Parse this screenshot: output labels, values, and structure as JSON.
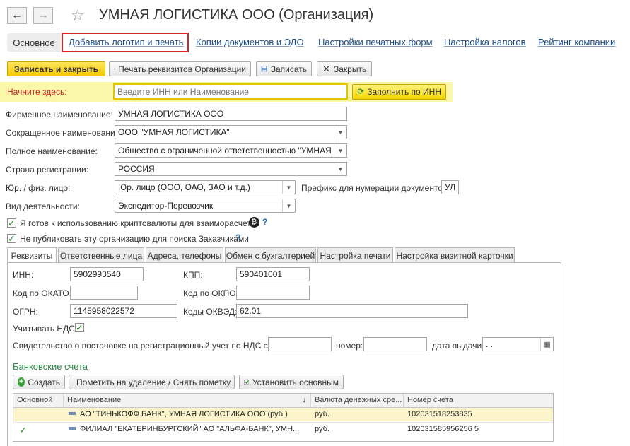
{
  "header": {
    "title": "УМНАЯ ЛОГИСТИКА ООО (Организация)",
    "back_glyph": "←",
    "forward_glyph": "→",
    "star_glyph": "☆"
  },
  "main_tabs": {
    "basic": "Основное",
    "logo": "Добавить логотип и печать",
    "copies": "Копии документов и ЭДО",
    "print_settings": "Настройки печатных форм",
    "taxes": "Настройка налогов",
    "rating": "Рейтинг компании"
  },
  "toolbar": {
    "save_close": "Записать и закрыть",
    "print_details": "Печать реквизитов Организации",
    "save": "Записать",
    "close": "Закрыть"
  },
  "start": {
    "label": "Начните здесь:",
    "placeholder": "Введите ИНН или Наименование",
    "fill_button": "Заполнить по ИНН"
  },
  "form": {
    "firm_name_label": "Фирменное наименование:",
    "firm_name": "УМНАЯ ЛОГИСТИКА ООО",
    "short_name_label": "Сокращенное наименование:",
    "short_name": "ООО \"УМНАЯ ЛОГИСТИКА\"",
    "full_name_label": "Полное наименование:",
    "full_name": "Общество с ограниченной ответственностью \"УМНАЯ ЛОГИ",
    "country_label": "Страна регистрации:",
    "country": "РОССИЯ",
    "entity_label": "Юр. / физ. лицо:",
    "entity": "Юр. лицо (ООО, ОАО, ЗАО и т.д.)",
    "prefix_label": "Префикс для нумерации документов :",
    "prefix": "УЛ",
    "activity_label": "Вид деятельности:",
    "activity": "Экспедитор-Перевозчик",
    "crypto_label": "Я готов к использованию криптовалюты для взаиморасчетов",
    "crypto_glyph": "₿",
    "nopublish_label": "Не публиковать эту организацию для поиска Заказчиками",
    "help_glyph": "?",
    "check_glyph": "✓"
  },
  "sub_tabs": [
    "Реквизиты",
    "Ответственные лица",
    "Адреса, телефоны",
    "Обмен с бухгалтерией",
    "Настройка печати",
    "Настройка визитной карточки"
  ],
  "details": {
    "inn_label": "ИНН:",
    "inn": "5902993540",
    "kpp_label": "КПП:",
    "kpp": "590401001",
    "okato_label": "Код по ОКАТО:",
    "okato": "",
    "okpo_label": "Код по ОКПО:",
    "okpo": "",
    "ogrn_label": "ОГРН:",
    "ogrn": "1145958022572",
    "okved_label": "Коды ОКВЭД:",
    "okved": "62.01",
    "vat_label": "Учитывать НДС:",
    "cert_label": "Свидетельство о постановке на регистрационный учет по НДС серия:",
    "cert_series": "",
    "number_label": "номер:",
    "number": "",
    "issue_label": "дата выдачи:",
    "issue_date": " .  .",
    "calendar_glyph": "▦"
  },
  "bank": {
    "title": "Банковские счета",
    "create": "Создать",
    "mark_delete": "Пометить на удаление / Снять пометку",
    "set_main": "Установить основным",
    "columns": [
      "Основной",
      "Наименование",
      "Валюта денежных сре...",
      "Номер счета"
    ],
    "sort_glyph": "↓",
    "rows": [
      {
        "main": "",
        "name": "АО \"ТИНЬКОФФ БАНК\", УМНАЯ ЛОГИСТИКА ООО (руб.)",
        "currency": "руб.",
        "account": "102031518253835"
      },
      {
        "main": "✓",
        "name": "ФИЛИАЛ \"ЕКАТЕРИНБУРГСКИЙ\" АО \"АЛЬФА-БАНК\", УМН...",
        "currency": "руб.",
        "account": "102031585956256 5"
      }
    ]
  },
  "colors": {
    "accent_yellow": "#f4c900",
    "link_blue": "#1c4f8c",
    "highlight": "#d9232d",
    "section_green": "#2e8b4a"
  }
}
